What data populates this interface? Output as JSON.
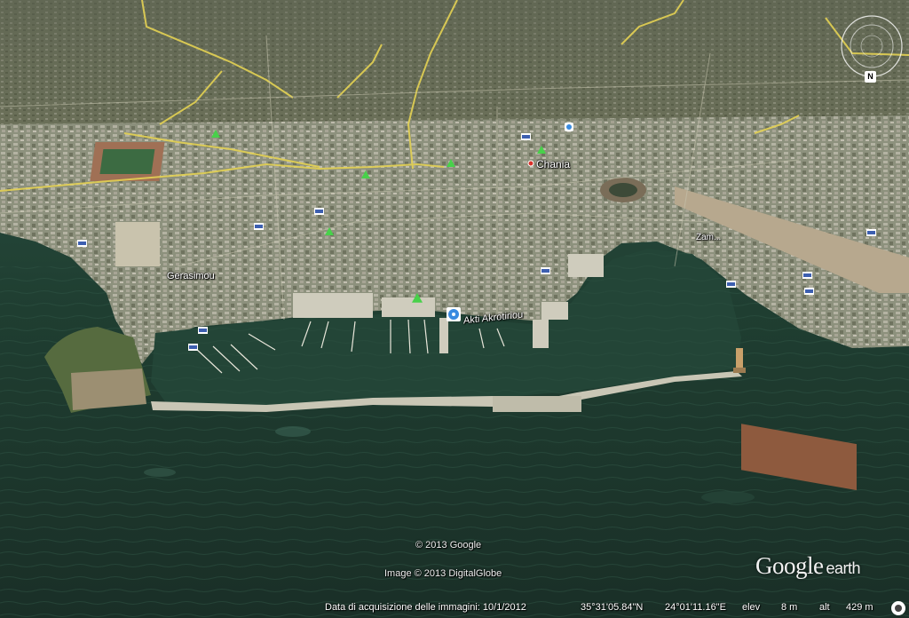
{
  "map": {
    "city_label": "Chania",
    "district_label": "Gerasimou",
    "harbour_label": "Akti Akrotiriou",
    "east_label": "Zam..."
  },
  "attribution": {
    "google_copyright": "© 2013 Google",
    "imagery_copyright": "Image © 2013 DigitalGlobe",
    "logo_google": "Google",
    "logo_earth": "earth"
  },
  "status_bar": {
    "acquisition_date": "Data di acquisizione delle immagini: 10/1/2012",
    "latitude": "35°31'05.84\"N",
    "longitude": "24°01'11.16\"E",
    "elev_label": "elev",
    "elev_value": "8 m",
    "alt_label": "alt",
    "alt_value": "429 m"
  },
  "navigation": {
    "north_label": "N"
  },
  "colors": {
    "sea": "#1f3a2f",
    "city": "#8a8f7a",
    "road_yellow": "#e6d35a",
    "park_marker": "#48d14a",
    "info_marker": "#3a8be0"
  },
  "icons": [
    "park-marker-icon",
    "hotel-marker-icon",
    "info-marker-icon",
    "navigation-compass-icon",
    "streaming-icon"
  ]
}
